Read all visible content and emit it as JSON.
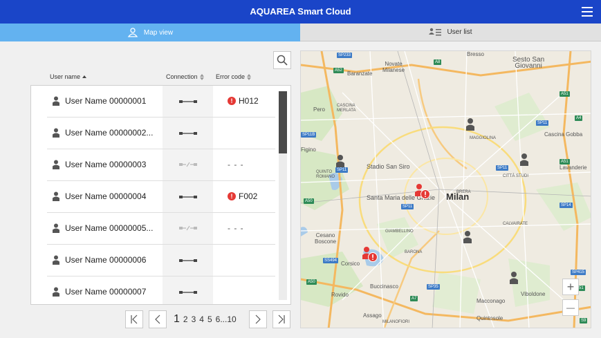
{
  "app": {
    "title": "AQUAREA Smart Cloud"
  },
  "tabs": {
    "map_view": "Map view",
    "user_list": "User list"
  },
  "table": {
    "columns": {
      "user_name": "User name",
      "connection": "Connection",
      "error_code": "Error code"
    },
    "rows": [
      {
        "name": "User Name 00000001",
        "connection": "connected",
        "error": "H012"
      },
      {
        "name": "User Name 00000002...",
        "connection": "connected",
        "error": ""
      },
      {
        "name": "User Name 00000003",
        "connection": "disconnected",
        "error": "- - -"
      },
      {
        "name": "User Name 00000004",
        "connection": "connected",
        "error": "F002"
      },
      {
        "name": "User Name 00000005...",
        "connection": "disconnected",
        "error": "- - -"
      },
      {
        "name": "User Name 00000006",
        "connection": "connected",
        "error": ""
      },
      {
        "name": "User Name 00000007",
        "connection": "connected",
        "error": ""
      }
    ]
  },
  "pagination": {
    "current": "1",
    "pages": [
      "2",
      "3",
      "4",
      "5",
      "6"
    ],
    "ellipsis": "...",
    "last": "10"
  },
  "map": {
    "city": "Milan",
    "places": {
      "bresso": "Bresso",
      "sesto": "Sesto San\nGiovanni",
      "novate": "Novate\nMilanese",
      "baranzate": "Baranzate",
      "pero": "Pero",
      "cascina": "CASCINA\nMERLATA",
      "figino": "Figino",
      "stadio": "Stadio San Siro",
      "lavanderie": "Lavanderie",
      "santa_maria": "Santa Maria delle Grazie",
      "cesano": "Cesano\nBoscone",
      "corsico": "Corsico",
      "buccinasco": "Buccinasco",
      "rovido": "Rovido",
      "assago": "Assago",
      "macconago": "Macconago",
      "quintosole": "Quintosole",
      "viboldone": "Viboldone",
      "cascina_gobba": "Cascina Gobba",
      "brera": "BRERA",
      "maggiolina": "MAGGIOLINA",
      "citta_studi": "CITTÀ STUDI",
      "calvairate": "CALVAIRATE",
      "quinto": "QUINTO\nROMANO",
      "giambellino": "GIAMBELLINO",
      "barona": "BARONA",
      "milanofiori": "MILANOFIORI"
    },
    "roads": [
      "SP233",
      "A52",
      "A8",
      "SP11",
      "SP11B",
      "A50",
      "SP11",
      "A51",
      "SP11",
      "A51",
      "SS494",
      "SP35",
      "A7",
      "SP14",
      "SP415",
      "A50",
      "S9",
      "A51",
      "A4",
      "SP11"
    ]
  },
  "zoom": {
    "in": "+",
    "out": "—"
  },
  "colors": {
    "header": "#1a45c8",
    "tab_active": "#63b2f0",
    "error": "#e53935",
    "scroll_thumb": "#4a4a4a"
  },
  "icons": [
    "hamburger-menu-icon",
    "map-person-icon",
    "user-list-icon",
    "search-icon",
    "sort-icon",
    "user-icon",
    "connection-icon",
    "error-icon",
    "first-page-icon",
    "prev-page-icon",
    "next-page-icon",
    "last-page-icon",
    "map-pin-icon"
  ]
}
